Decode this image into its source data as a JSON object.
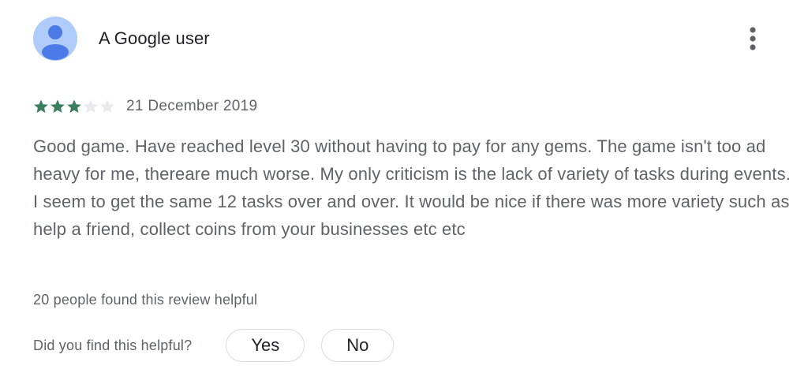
{
  "review": {
    "author": "A Google user",
    "avatar_icon": "person-icon",
    "menu_icon": "more-vert-icon",
    "rating": 3,
    "rating_max": 5,
    "date": "21 December 2019",
    "text": "Good game. Have reached level 30 without having to pay for any gems. The game isn't too ad heavy for me, thereare much worse. My only criticism is the lack of variety of tasks during events. I seem to get the same 12 tasks over and over. It would be nice if there was more variety such as help a friend, collect coins from your businesses etc etc",
    "helpful_count_text": "20 people found this review helpful"
  },
  "feedback": {
    "question": "Did you find this helpful?",
    "yes_label": "Yes",
    "no_label": "No"
  },
  "colors": {
    "star_filled": "#3b7f5f",
    "star_empty": "#e8eaed",
    "avatar_bg": "#aecbfa",
    "avatar_person": "#4c7ae6",
    "menu_dots": "#5f6368"
  }
}
